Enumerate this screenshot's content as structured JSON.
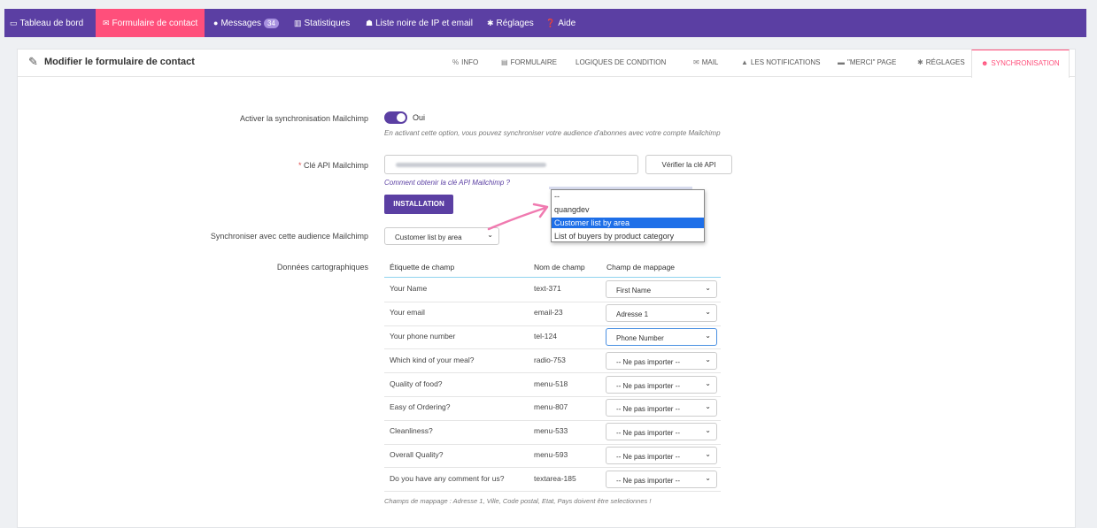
{
  "nav": {
    "items": [
      {
        "label": "Tableau de bord",
        "icon": "monitor-icon"
      },
      {
        "label": "Formulaire de contact",
        "icon": "envelope-icon"
      },
      {
        "label": "Messages",
        "icon": "comments-icon",
        "badge": "34"
      },
      {
        "label": "Statistiques",
        "icon": "chart-icon"
      },
      {
        "label": "Liste noire de IP et email",
        "icon": "users-block-icon"
      },
      {
        "label": "Réglages",
        "icon": "gear-icon"
      },
      {
        "label": "Aide",
        "icon": "help-icon"
      }
    ]
  },
  "page": {
    "title": "Modifier le formulaire de contact",
    "tabs": [
      {
        "label": "INFO",
        "icon": "info-icon"
      },
      {
        "label": "FORMULAIRE",
        "icon": "form-icon"
      },
      {
        "label": "LOGIQUES DE CONDITION",
        "icon": ""
      },
      {
        "label": "MAIL",
        "icon": "mail-icon"
      },
      {
        "label": "LES NOTIFICATIONS",
        "icon": "bell-icon"
      },
      {
        "label": "\"MERCI\" PAGE",
        "icon": "thanks-icon"
      },
      {
        "label": "RÉGLAGES",
        "icon": "gear-icon"
      },
      {
        "label": "SYNCHRONISATION",
        "icon": "mailchimp-icon"
      }
    ]
  },
  "form": {
    "enable_label": "Activer la synchronisation Mailchimp",
    "toggle_text": "Oui",
    "toggle_note": "En activant cette option, vous pouvez synchroniser votre audience d'abonnes avec votre compte Mailchimp",
    "api_required": "*",
    "api_label": "Clé API Mailchimp",
    "verify_button": "Vérifier la clé API",
    "api_help_link": "Comment obtenir la clé API Mailchimp ?",
    "install_button": "INSTALLATION",
    "audience_label": "Synchroniser avec cette audience Mailchimp",
    "audience_selected": "Customer list by area",
    "audience_options": [
      "--",
      "quangdev",
      "Customer list by area",
      "List of buyers by product category"
    ],
    "mapping_label": "Données cartographiques"
  },
  "table": {
    "headers": [
      "Étiquette de champ",
      "Nom de champ",
      "Champ de mappage"
    ],
    "rows": [
      {
        "label": "Your Name",
        "name": "text-371",
        "mapping": "First Name"
      },
      {
        "label": "Your email",
        "name": "email-23",
        "mapping": "Adresse 1"
      },
      {
        "label": "Your phone number",
        "name": "tel-124",
        "mapping": "Phone Number"
      },
      {
        "label": "Which kind of your meal?",
        "name": "radio-753",
        "mapping": "-- Ne pas importer --"
      },
      {
        "label": "Quality of food?",
        "name": "menu-518",
        "mapping": "-- Ne pas importer --"
      },
      {
        "label": "Easy of Ordering?",
        "name": "menu-807",
        "mapping": "-- Ne pas importer --"
      },
      {
        "label": "Cleanliness?",
        "name": "menu-533",
        "mapping": "-- Ne pas importer --"
      },
      {
        "label": "Overall Quality?",
        "name": "menu-593",
        "mapping": "-- Ne pas importer --"
      },
      {
        "label": "Do you have any comment for us?",
        "name": "textarea-185",
        "mapping": "-- Ne pas importer --"
      }
    ],
    "note": "Champs de mappage : Adresse 1, Ville, Code postal, Etat, Pays doivent être selectionnes !"
  },
  "colors": {
    "brand": "#5b3fa3",
    "accent": "#ff4f7b",
    "highlight": "#1e6fe8"
  }
}
